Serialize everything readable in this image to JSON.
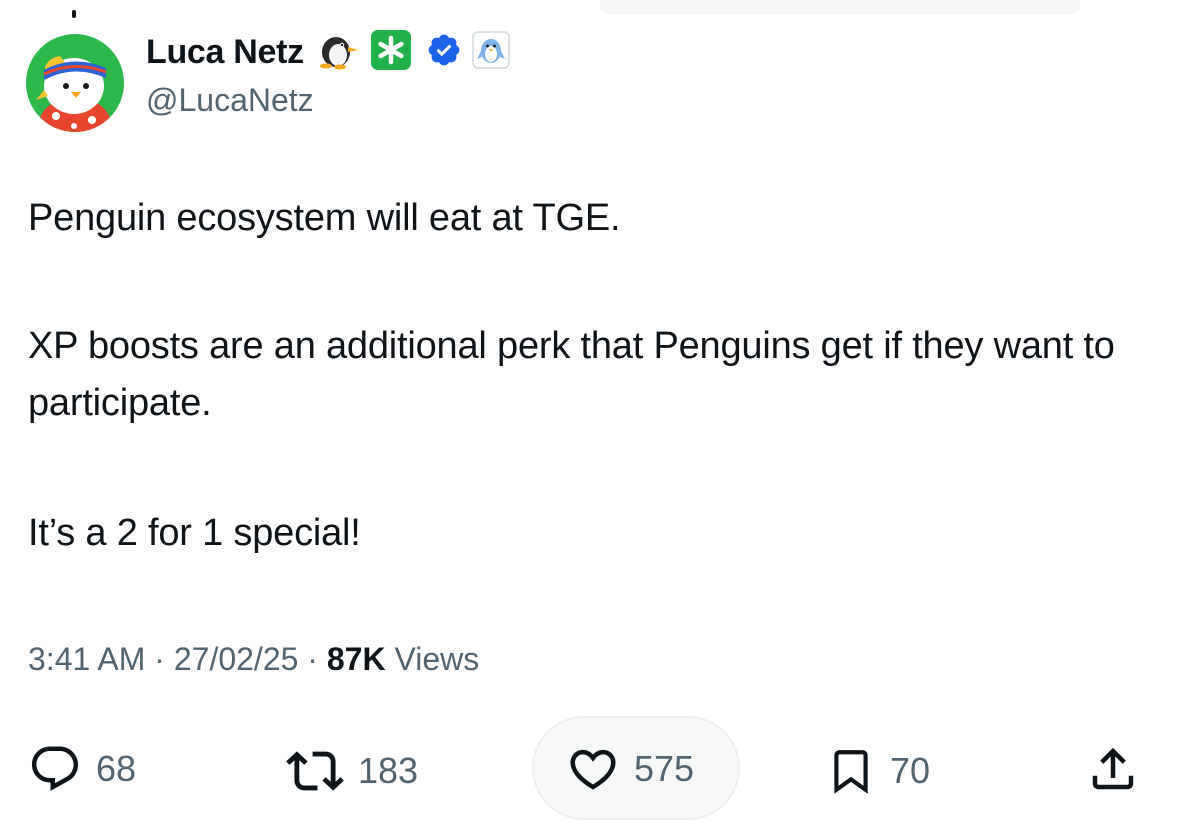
{
  "author": {
    "display_name": "Luca Netz",
    "handle": "@LucaNetz",
    "badges": [
      "penguin-emoji-icon",
      "asterisk-badge-icon",
      "verified-icon",
      "affiliate-penguin-icon"
    ]
  },
  "tweet": {
    "paragraphs": [
      "Penguin ecosystem will eat at TGE.",
      "XP boosts are an additional perk that Penguins get if they want to participate.",
      "It’s a 2 for 1 special!"
    ]
  },
  "meta": {
    "time": "3:41 AM",
    "separator": " · ",
    "date": "27/02/25",
    "views_count": "87K",
    "views_label": " Views"
  },
  "actions": {
    "replies": "68",
    "reposts": "183",
    "likes": "575",
    "bookmarks": "70"
  },
  "colors": {
    "text": "#0f1419",
    "secondary": "#536471",
    "verified": "#1d63e9",
    "asterisk_badge": "#22b04a",
    "avatar_bg": "#2db84b"
  }
}
